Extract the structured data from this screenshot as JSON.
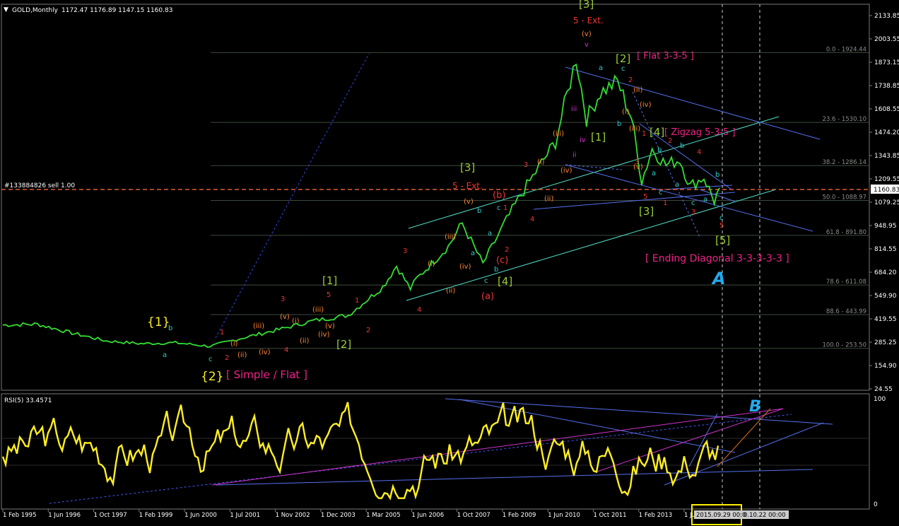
{
  "header": {
    "title": "GOLD,Monthly",
    "ohlc": "1172.47 1176.89 1147.15 1160.83",
    "current_price": "1160.83",
    "hline_label": "#133884826 sell 1.00"
  },
  "rsi": {
    "title": "RSI(5) 33.4571",
    "levels": [
      "100",
      "0"
    ]
  },
  "chart_data": {
    "type": "line",
    "title": "GOLD,Monthly",
    "price_axis": [
      "2133.85",
      "2003.55",
      "1873.15",
      "1738.85",
      "1608.55",
      "1474.20",
      "1343.85",
      "1209.55",
      "1079.25",
      "948.95",
      "814.55",
      "684.20",
      "549.90",
      "419.55",
      "285.25",
      "154.90",
      "24.55"
    ],
    "x_labels": [
      "1 Feb 1995",
      "1 Jun 1996",
      "1 Oct 1997",
      "1 Feb 1999",
      "1 Jun 2000",
      "1 Jul 2001",
      "1 Nov 2002",
      "1 Dec 2003",
      "1 Mar 2005",
      "1 Jun 2006",
      "1 Oct 2007",
      "1 Feb 2009",
      "1 Jun 2010",
      "1 Oct 2011",
      "1 Feb 2013",
      "1 Ju"
    ],
    "cursor_label": "2015.09.29 00:0",
    "cursor_label2": "0.10.22 00:00",
    "price_points": [
      [
        1995,
        385
      ],
      [
        1996,
        390
      ],
      [
        1997,
        340
      ],
      [
        1998,
        295
      ],
      [
        1999,
        280
      ],
      [
        2000,
        285
      ],
      [
        2001,
        265
      ],
      [
        2002,
        315
      ],
      [
        2003,
        360
      ],
      [
        2004,
        410
      ],
      [
        2005,
        440
      ],
      [
        2006,
        600
      ],
      [
        2006.4,
        720
      ],
      [
        2006.8,
        590
      ],
      [
        2007,
        650
      ],
      [
        2007.9,
        830
      ],
      [
        2008.3,
        960
      ],
      [
        2008.9,
        730
      ],
      [
        2009.5,
        950
      ],
      [
        2010,
        1120
      ],
      [
        2010.6,
        1300
      ],
      [
        2011,
        1420
      ],
      [
        2011.6,
        1895
      ],
      [
        2011.9,
        1550
      ],
      [
        2012.3,
        1700
      ],
      [
        2012.8,
        1760
      ],
      [
        2013.2,
        1560
      ],
      [
        2013.5,
        1200
      ],
      [
        2013.8,
        1380
      ],
      [
        2014.2,
        1290
      ],
      [
        2014.6,
        1320
      ],
      [
        2014.9,
        1170
      ],
      [
        2015.3,
        1220
      ],
      [
        2015.6,
        1085
      ],
      [
        2015.75,
        1160
      ]
    ],
    "fib_levels": [
      {
        "label": "0.0 - 1924.44",
        "price": 1924.44
      },
      {
        "label": "23.6 - 1530.10",
        "price": 1530.1
      },
      {
        "label": "38.2 - 1286.14",
        "price": 1286.14
      },
      {
        "label": "50.0 - 1088.97",
        "price": 1088.97
      },
      {
        "label": "61.8 - 891.80",
        "price": 891.8
      },
      {
        "label": "78.6 - 611.08",
        "price": 611.08
      },
      {
        "label": "88.6 - 443.99",
        "price": 443.99
      },
      {
        "label": "100.0 - 253.50",
        "price": 253.5
      }
    ],
    "annotations": {
      "wave_1_curly": "{1}",
      "wave_2_curly": "{2}",
      "simple_flat": "[ Simple / Flat ]",
      "sq1": "[1]",
      "sq2": "[2]",
      "sq3": "[3]",
      "sq4": "[4]",
      "top3": "[3]",
      "ext5_top": "5 - Ext.",
      "v_paren": "(v)",
      "v_roman": "v",
      "flat_label": "[ Flat 3-3-5 ]",
      "sq2_top": "[2]",
      "zigzag_label": "[ Zigzag 5-3-5 ]",
      "sq4_r": "[4]",
      "sq1_r": "[1]",
      "sq3_r": "[3]",
      "sq5_r": "[5]",
      "ending_diag": "[ Ending Diagonal 3-3-3-3-3 ]",
      "ext5_mid": "5 - Ext.",
      "b_paren": "(b)",
      "c_paren": "(c)",
      "a_paren": "(a)",
      "big_A": "A",
      "big_B": "B"
    }
  }
}
